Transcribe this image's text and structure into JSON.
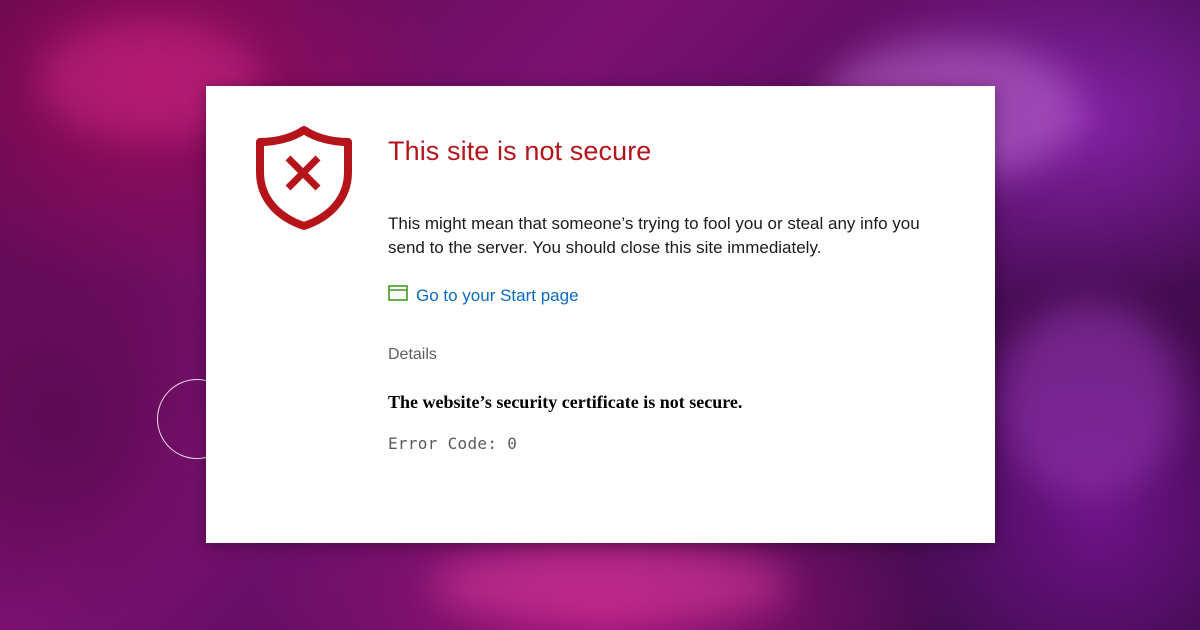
{
  "colors": {
    "title_red": "#b4141a",
    "link_blue": "#0a6bc1",
    "start_icon_green": "#3f9b1f",
    "background_magenta": "#7a1070"
  },
  "warning": {
    "icon": "shield-x-icon",
    "title": "This site is not secure",
    "description": "This might mean that someone’s trying to fool you or steal any info you send to the server. You should close this site immediately.",
    "start_link": {
      "icon": "browser-window-icon",
      "label": "Go to your Start page"
    },
    "details_label": "Details",
    "certificate_message": "The website’s security certificate is not secure.",
    "error_code": "Error Code: 0"
  }
}
